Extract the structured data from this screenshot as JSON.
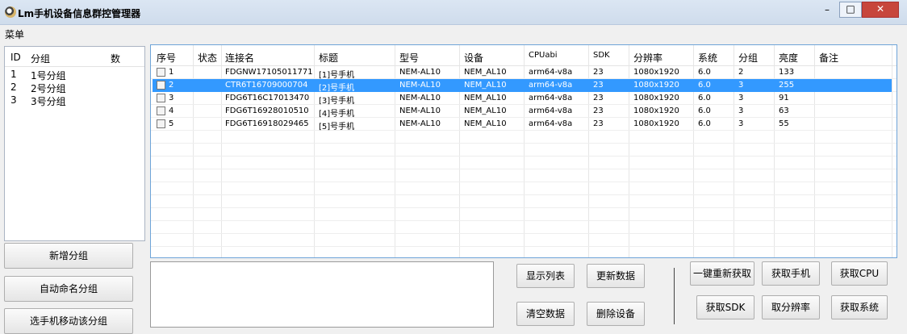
{
  "window": {
    "title": "Lm手机设备信息群控管理器",
    "minimize_glyph": "–",
    "maximize_glyph": "□",
    "close_glyph": "✕"
  },
  "menu": {
    "label": "菜单"
  },
  "groups": {
    "headers": {
      "id": "ID",
      "name": "分组",
      "count": "数"
    },
    "rows": [
      {
        "id": "1",
        "name": "1号分组"
      },
      {
        "id": "2",
        "name": "2号分组"
      },
      {
        "id": "3",
        "name": "3号分组"
      }
    ]
  },
  "left_buttons": {
    "add_group": "新增分组",
    "auto_name": "自动命名分组",
    "partial": "选手机移动该分组"
  },
  "devices": {
    "headers": {
      "seq": "序号",
      "status": "状态",
      "conn": "连接名",
      "title": "标题",
      "model": "型号",
      "device": "设备",
      "cpu": "CPUabi",
      "sdk": "SDK",
      "res": "分辨率",
      "sys": "系统",
      "group": "分组",
      "bright": "亮度",
      "note": "备注"
    },
    "rows": [
      {
        "seq": "1",
        "conn": "FDGNW17105011771",
        "title": "[1]号手机",
        "model": "NEM-AL10",
        "device": "NEM_AL10",
        "cpu": "arm64-v8a",
        "sdk": "23",
        "res": "1080x1920",
        "sys": "6.0",
        "group": "2",
        "bright": "133"
      },
      {
        "seq": "2",
        "conn": "CTR6T16709000704",
        "title": "[2]号手机",
        "model": "NEM-AL10",
        "device": "NEM_AL10",
        "cpu": "arm64-v8a",
        "sdk": "23",
        "res": "1080x1920",
        "sys": "6.0",
        "group": "3",
        "bright": "255"
      },
      {
        "seq": "3",
        "conn": "FDG6T16C17013470",
        "title": "[3]号手机",
        "model": "NEM-AL10",
        "device": "NEM_AL10",
        "cpu": "arm64-v8a",
        "sdk": "23",
        "res": "1080x1920",
        "sys": "6.0",
        "group": "3",
        "bright": "91"
      },
      {
        "seq": "4",
        "conn": "FDG6T16928010510",
        "title": "[4]号手机",
        "model": "NEM-AL10",
        "device": "NEM_AL10",
        "cpu": "arm64-v8a",
        "sdk": "23",
        "res": "1080x1920",
        "sys": "6.0",
        "group": "3",
        "bright": "63"
      },
      {
        "seq": "5",
        "conn": "FDG6T16918029465",
        "title": "[5]号手机",
        "model": "NEM-AL10",
        "device": "NEM_AL10",
        "cpu": "arm64-v8a",
        "sdk": "23",
        "res": "1080x1920",
        "sys": "6.0",
        "group": "3",
        "bright": "55"
      }
    ]
  },
  "actions": {
    "show_list": "显示列表",
    "refresh": "更新数据",
    "clear": "清空数据",
    "delete": "删除设备",
    "one_key": "一键重新获取",
    "get_phone": "获取手机",
    "get_cpu": "获取CPU",
    "get_sdk": "获取SDK",
    "get_res": "取分辨率",
    "get_sys": "获取系统"
  },
  "colors": {
    "selection": "#3399ff",
    "close": "#c7463c"
  }
}
